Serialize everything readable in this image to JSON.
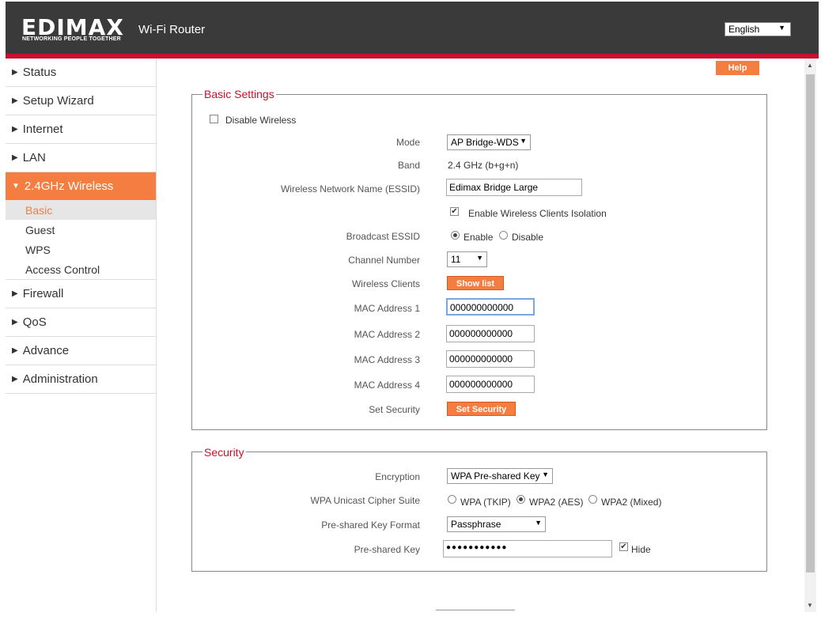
{
  "header": {
    "logo_text": "EDIMAX",
    "logo_tagline": "NETWORKING PEOPLE TOGETHER",
    "title": "Wi-Fi Router",
    "language": "English"
  },
  "sidebar": {
    "items": [
      {
        "label": "Status"
      },
      {
        "label": "Setup Wizard"
      },
      {
        "label": "Internet"
      },
      {
        "label": "LAN"
      },
      {
        "label": "2.4GHz Wireless"
      },
      {
        "label": "Firewall"
      },
      {
        "label": "QoS"
      },
      {
        "label": "Advance"
      },
      {
        "label": "Administration"
      }
    ],
    "sub_items": [
      {
        "label": "Basic"
      },
      {
        "label": "Guest"
      },
      {
        "label": "WPS"
      },
      {
        "label": "Access Control"
      }
    ]
  },
  "help_label": "Help",
  "basic": {
    "legend": "Basic Settings",
    "disable_wireless": "Disable  Wireless",
    "mode_label": "Mode",
    "mode_value": "AP Bridge-WDS",
    "band_label": "Band",
    "band_value": "2.4 GHz (b+g+n)",
    "essid_label": "Wireless Network Name  (ESSID)",
    "essid_value": "Edimax Bridge Large",
    "isolation_label": "Enable Wireless Clients Isolation",
    "broadcast_label": "Broadcast ESSID",
    "broadcast_enable": "Enable",
    "broadcast_disable": "Disable",
    "channel_label": "Channel Number",
    "channel_value": "11",
    "clients_label": "Wireless Clients",
    "show_list": "Show list",
    "mac1_label": "MAC Address  1",
    "mac1_value": "000000000000",
    "mac2_label": "MAC Address  2",
    "mac2_value": "000000000000",
    "mac3_label": "MAC Address  3",
    "mac3_value": "000000000000",
    "mac4_label": "MAC Address  4",
    "mac4_value": "000000000000",
    "set_security_label": "Set Security",
    "set_security_button": "Set Security"
  },
  "security": {
    "legend": "Security",
    "encryption_label": "Encryption",
    "encryption_value": "WPA Pre-shared Key",
    "cipher_label": "WPA Unicast Cipher Suite",
    "cipher_tkip": "WPA (TKIP)",
    "cipher_aes": "WPA2 (AES)",
    "cipher_mixed": "WPA2 (Mixed)",
    "key_format_label": "Pre-shared Key Format",
    "key_format_value": "Passphrase",
    "key_label": "Pre-shared Key",
    "key_value": "●●●●●●●●●●●",
    "hide_label": "Hide"
  }
}
